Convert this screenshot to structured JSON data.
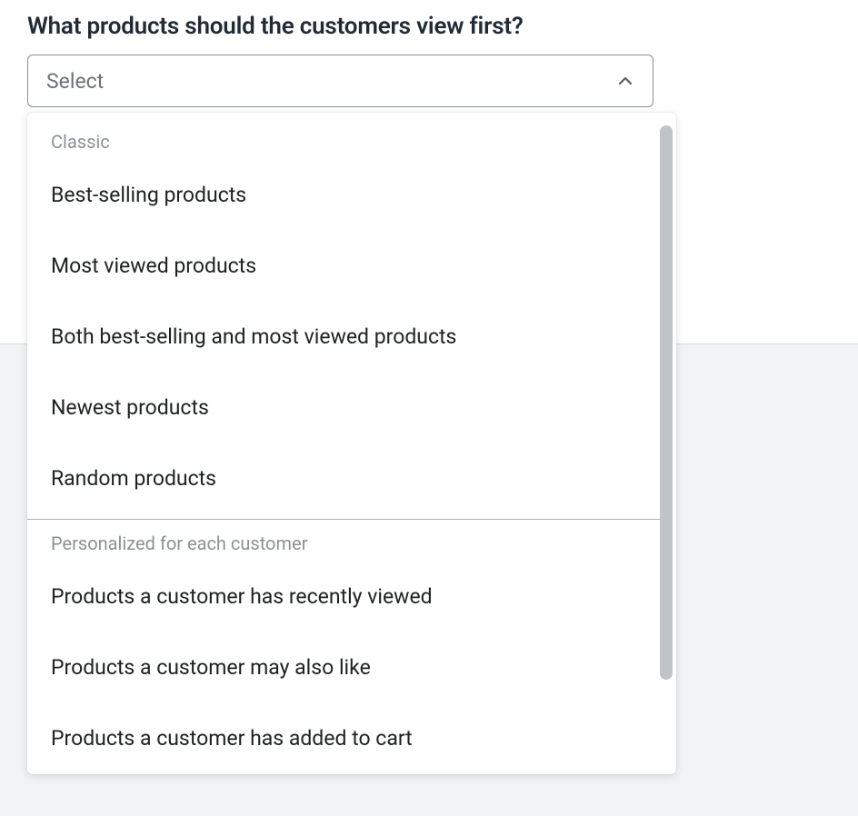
{
  "field": {
    "label": "What products should the customers view first?",
    "placeholder": "Select"
  },
  "dropdown": {
    "groups": [
      {
        "header": "Classic",
        "options": [
          "Best-selling products",
          "Most viewed products",
          "Both best-selling and most viewed products",
          "Newest products",
          "Random products"
        ]
      },
      {
        "header": "Personalized for each customer",
        "options": [
          "Products a customer has recently viewed",
          "Products a customer may also like",
          "Products a customer has added to cart"
        ]
      }
    ]
  }
}
